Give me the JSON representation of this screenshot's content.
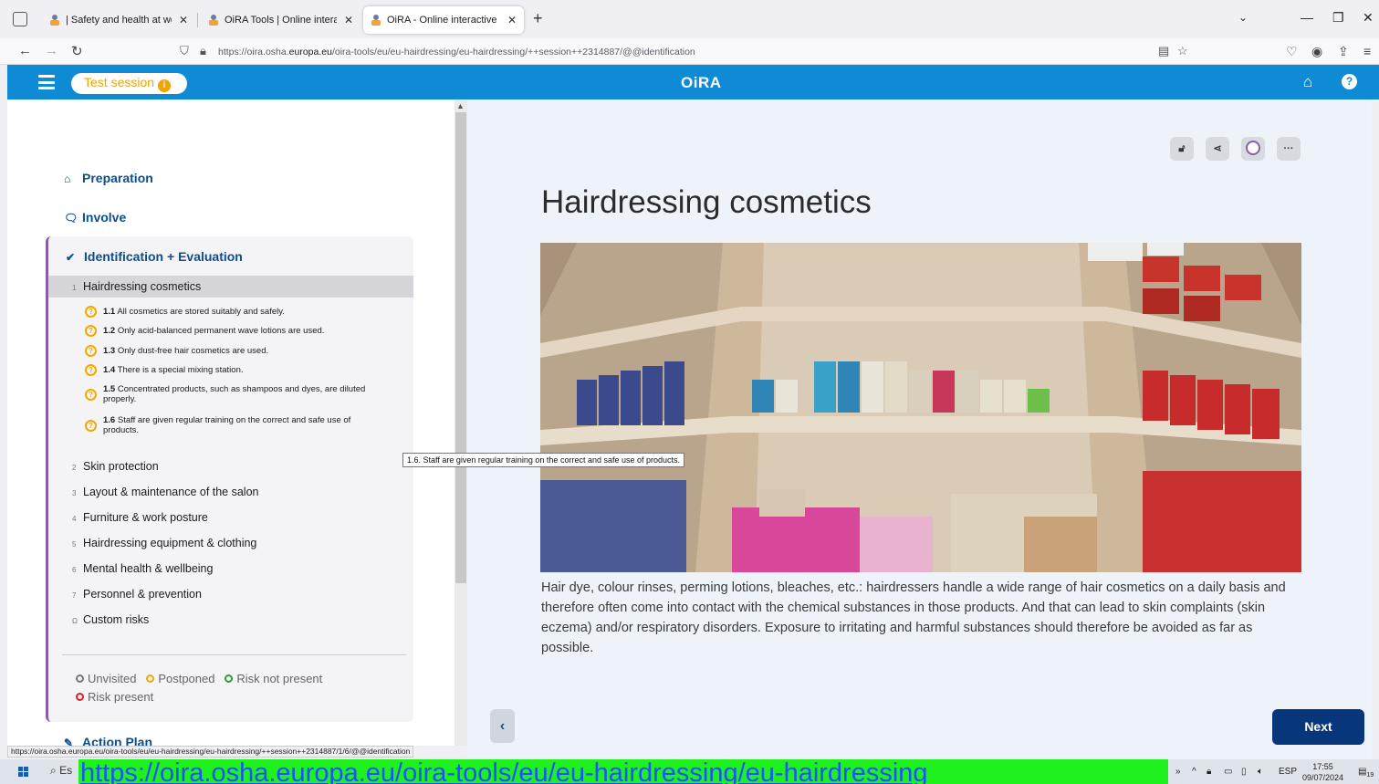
{
  "browser": {
    "tabs": [
      {
        "label": "| Safety and health at work EU-O"
      },
      {
        "label": "OiRA Tools | Online interactive R"
      },
      {
        "label": "OiRA - Online interactive Risk A"
      }
    ],
    "url_prefix": "https://oira.osha.",
    "url_domain": "europa.eu",
    "url_suffix": "/oira-tools/eu/eu-hairdressing/eu-hairdressing/++session++2314887/@@identification"
  },
  "header": {
    "session_label": "Test session",
    "logo": "OiRA"
  },
  "sidebar": {
    "preparation": "Preparation",
    "involve": "Involve",
    "ident": "Identification + Evaluation",
    "modules": [
      {
        "num": "1",
        "label": "Hairdressing cosmetics"
      },
      {
        "num": "2",
        "label": "Skin protection"
      },
      {
        "num": "3",
        "label": "Layout & maintenance of the salon"
      },
      {
        "num": "4",
        "label": "Furniture & work posture"
      },
      {
        "num": "5",
        "label": "Hairdressing equipment & clothing"
      },
      {
        "num": "6",
        "label": "Mental health & wellbeing"
      },
      {
        "num": "7",
        "label": "Personnel & prevention"
      },
      {
        "num": "Ω",
        "label": "Custom risks"
      }
    ],
    "questions": [
      {
        "num": "1.1",
        "text": "All cosmetics are stored suitably and safely."
      },
      {
        "num": "1.2",
        "text": "Only acid-balanced permanent wave lotions are used."
      },
      {
        "num": "1.3",
        "text": "Only dust-free hair cosmetics are used."
      },
      {
        "num": "1.4",
        "text": "There is a special mixing station."
      },
      {
        "num": "1.5",
        "text": "Concentrated products, such as shampoos and dyes, are diluted properly."
      },
      {
        "num": "1.6",
        "text": "Staff are given regular training on the correct and safe use of products."
      }
    ],
    "legend": {
      "unvisited": "Unvisited",
      "postponed": "Postponed",
      "not_present": "Risk not present",
      "present": "Risk present"
    },
    "action_plan": "Action Plan"
  },
  "main": {
    "title": "Hairdressing cosmetics",
    "description": "Hair dye, colour rinses, perming lotions, bleaches, etc.: hairdressers handle a wide range of hair cosmetics on a daily basis and therefore often come into contact with the chemical substances in those products. And that can lead to skin complaints (skin eczema) and/or respiratory disorders. Exposure to irritating and harmful substances should therefore be avoided as far as possible.",
    "next_label": "Next"
  },
  "tooltip": "1.6. Staff are given regular training on the correct and safe use of products.",
  "status_url": "https://oira.osha.europa.eu/oira-tools/eu/eu-hairdressing/eu-hairdressing/++session++2314887/1/6/@@identification",
  "taskbar": {
    "search_hint": "Es",
    "green_url": "https://oira.osha.europa.eu/oira-tools/eu/eu-hairdressing/eu-hairdressing",
    "lang": "ESP",
    "time": "17:55",
    "date": "09/07/2024",
    "notif_count": "19"
  },
  "colors": {
    "brand_blue": "#0f8bd6",
    "navy": "#07367a",
    "postponed": "#f2a900",
    "section_accent": "#8a5da8"
  }
}
